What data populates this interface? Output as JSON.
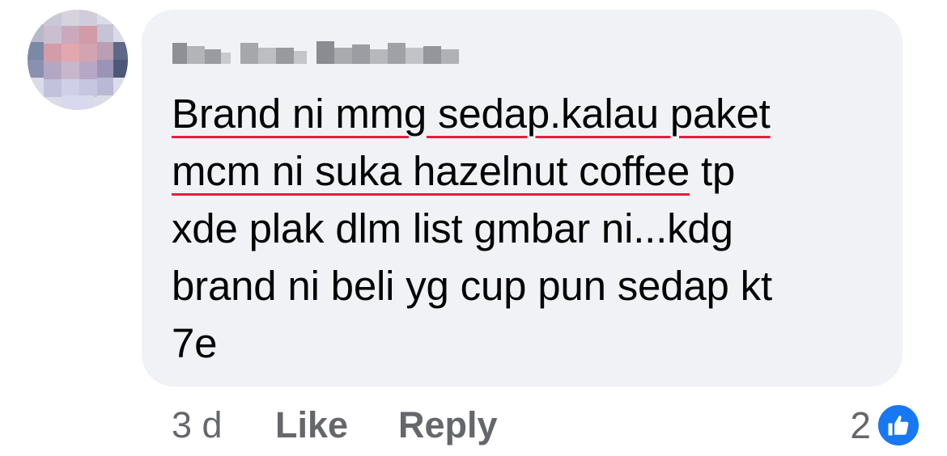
{
  "comment": {
    "author": {
      "name": "Mk Hen Hen"
    },
    "text_lines": [
      {
        "underlined": "Brand ni mmg sedap.kalau paket",
        "rest": ""
      },
      {
        "underlined": "mcm ni suka hazelnut coffee",
        "rest": " tp"
      },
      {
        "underlined": "",
        "rest": "xde plak dlm list gmbar ni...kdg"
      },
      {
        "underlined": "",
        "rest": "brand ni beli yg cup pun sedap kt"
      },
      {
        "underlined": "",
        "rest": "7e"
      }
    ],
    "timestamp": "3 d",
    "like_label": "Like",
    "reply_label": "Reply",
    "reaction_count": "2",
    "reaction_icon": "thumbs-up-icon"
  },
  "colors": {
    "bubble": "#f0f2f5",
    "text": "#050505",
    "secondary": "#65676b",
    "like_blue": "#1877f2",
    "spellcheck_red": "#e41e3f"
  }
}
